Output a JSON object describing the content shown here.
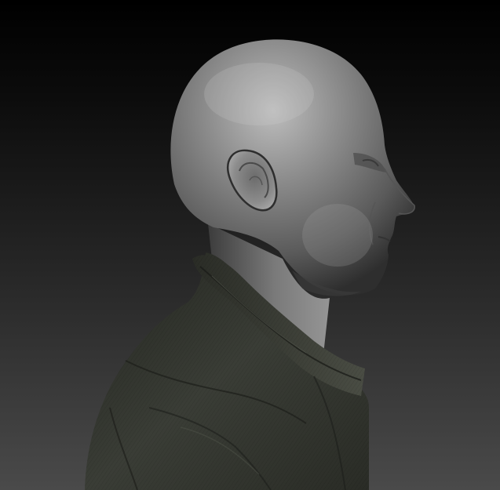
{
  "scene": {
    "subject": "sculpt-bust",
    "background_top": "#000000",
    "background_bottom": "#4a4a4a",
    "skin_color": "#8a8a8a",
    "jacket_color": "#3a3d36"
  }
}
